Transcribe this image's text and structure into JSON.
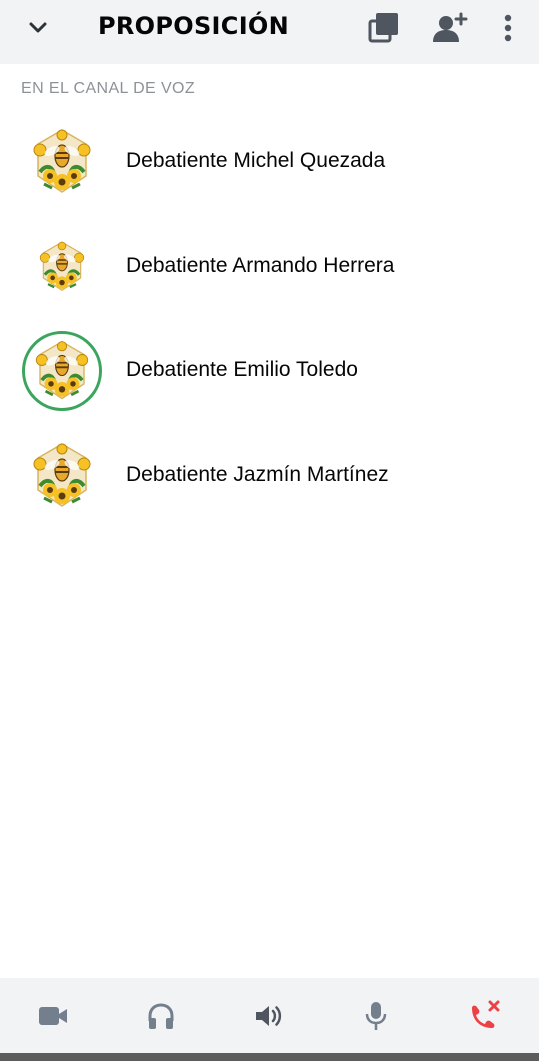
{
  "header": {
    "title": "PROPOSICIÓN",
    "icons": [
      "chevron-down-icon",
      "popout-icon",
      "add-person-icon",
      "more-vertical-icon"
    ]
  },
  "section": {
    "label": "EN EL CANAL DE VOZ"
  },
  "members": [
    {
      "name": "Debatiente Michel Quezada",
      "speaking": false
    },
    {
      "name": "Debatiente Armando Herrera",
      "speaking": false
    },
    {
      "name": "Debatiente Emilio Toledo",
      "speaking": true
    },
    {
      "name": "Debatiente Jazmín Martínez",
      "speaking": false
    }
  ],
  "footer": {
    "controls": [
      "video-camera-icon",
      "headphones-icon",
      "speaker-icon",
      "microphone-icon",
      "disconnect-call-icon"
    ]
  },
  "colors": {
    "speaking_ring": "#3ba55d",
    "disconnect": "#ed4245",
    "icon_gray": "#747f8d",
    "header_icon": "#4f5660"
  }
}
